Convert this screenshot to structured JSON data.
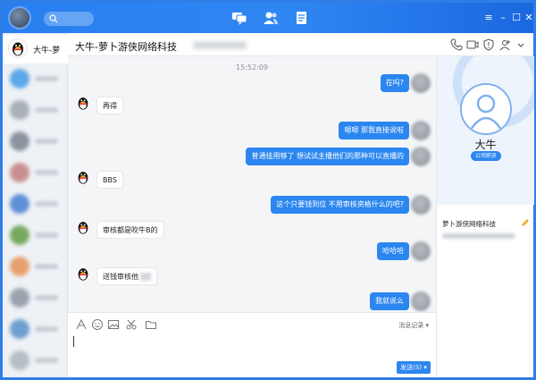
{
  "window": {
    "top_tabs": [
      {
        "icon": "chat-bubble-icon",
        "active": true
      },
      {
        "icon": "contacts-icon",
        "active": false
      },
      {
        "icon": "document-icon",
        "active": false
      }
    ],
    "controls": [
      "menu-icon",
      "minimize-icon",
      "maximize-icon",
      "close-icon"
    ]
  },
  "sidebar": {
    "active_contact": {
      "name": "大牛-萝"
    },
    "blurred_contacts": [
      {
        "color": "#5aa8e8"
      },
      {
        "color": "#a9b0b8"
      },
      {
        "color": "#8a949e"
      },
      {
        "color": "#c98f8f"
      },
      {
        "color": "#5f8fd6"
      },
      {
        "color": "#78a85f"
      },
      {
        "color": "#e6a070"
      },
      {
        "color": "#9aa3ad"
      },
      {
        "color": "#6e9fd0"
      },
      {
        "color": "#b7bec6"
      }
    ]
  },
  "chat": {
    "title": "大牛-萝卜游侠网络科技",
    "header_icons": [
      "phone-icon",
      "video-icon",
      "shield-icon",
      "add-user-icon",
      "more-icon"
    ],
    "timestamp": "15:52:09",
    "messages": [
      {
        "side": "out",
        "text": "在吗?"
      },
      {
        "side": "in",
        "text": "再得"
      },
      {
        "side": "out",
        "text": "嗯嗯  那我直接说啦"
      },
      {
        "side": "out",
        "text": "普通挂用够了  想试试主播他们的那种可以直播的"
      },
      {
        "side": "in",
        "text": "BBS"
      },
      {
        "side": "out",
        "text": "这个只要钱到位  不用审核资格什么的吧?"
      },
      {
        "side": "in",
        "text": "审核都是吹牛B的"
      },
      {
        "side": "out",
        "text": "哈哈哈"
      },
      {
        "side": "in",
        "text": "送钱审核他"
      },
      {
        "side": "out",
        "text": "我就说么"
      }
    ]
  },
  "input": {
    "tools": [
      "font-icon",
      "emoji-icon",
      "image-icon",
      "scissors-icon",
      "folder-icon"
    ],
    "history_label": "消息记录 ▾",
    "send_label": "发送(S) ▾"
  },
  "profile": {
    "name": "大牛",
    "badge": "公司职员",
    "group_name": "萝卜游侠网络科技"
  },
  "colors": {
    "accent": "#2b86f0",
    "titlebar": "#2a7ff0"
  }
}
